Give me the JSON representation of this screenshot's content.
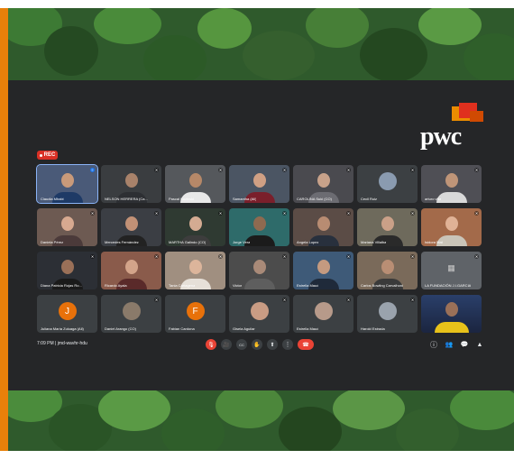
{
  "brand": {
    "logo_text": "pwc",
    "accent_color": "#e8800a"
  },
  "recording_badge": {
    "label": "REC",
    "color": "#d93025"
  },
  "participants": [
    "Claudia Mhabi",
    "NELSON HERRERA (Ca...",
    "Pascal Kozinski",
    "Stefi Barrios",
    "Samantha (All)",
    "CAROLINA Suki (CO)",
    "Cecil Ruiz",
    "arturo villa",
    "Daniela Pérez",
    "Mercedes Fernández",
    "MARTHA Galindo (CO)",
    "Jorge Vera",
    "Angela Lopez",
    "Mariana Villalba",
    "Isidora Mali",
    "Diana Patricia Rojas Ro...",
    "Ricardo Ayala",
    "Tania Cartagena",
    "Victor",
    "Estrella Maud",
    "Carlos Bowling Carvalhoni",
    "LA FUNDACIÓN J.I.GARCIA",
    "Juliana María Zuluaga (All)",
    "Daniel Arango (CO)",
    "Fabian Cardona",
    "Gisela Aguilar",
    "Estrella Maud",
    "Harold Estrada",
    "Presenter"
  ],
  "meeting_bar": {
    "time": "7:09 PM",
    "separator": "|",
    "meeting_code": "jmd-wavhr-hdu"
  },
  "controls": {
    "mic": "🎙",
    "camera": "🎥",
    "captions": "CC",
    "raise_hand": "✋",
    "present": "⬆",
    "more": "⋮",
    "leave": "☎"
  },
  "right_icons": {
    "info": "ⓘ",
    "people": "👥",
    "chat": "💬",
    "activities": "▲"
  }
}
